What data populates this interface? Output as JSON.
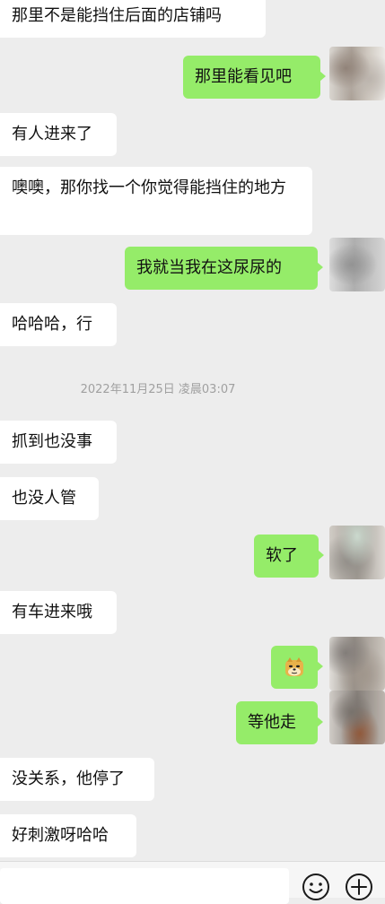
{
  "messages": [
    {
      "side": "left",
      "text": "那里不是能挡住后面的店铺吗"
    },
    {
      "side": "right",
      "text": "那里能看见吧"
    },
    {
      "side": "left",
      "text": "有人进来了"
    },
    {
      "side": "left",
      "text": "噢噢，那你找一个你觉得能挡住的地方"
    },
    {
      "side": "right",
      "text": "我就当我在这尿尿的"
    },
    {
      "side": "left",
      "text": "哈哈哈，行"
    },
    {
      "type": "timestamp",
      "text": "2022年11月25日 凌晨03:07"
    },
    {
      "side": "left",
      "text": "抓到也没事"
    },
    {
      "side": "left",
      "text": "也没人管"
    },
    {
      "side": "right",
      "text": "软了"
    },
    {
      "side": "left",
      "text": "有车进来哦"
    },
    {
      "side": "right",
      "type": "emoji",
      "emoji": "doge-emoji"
    },
    {
      "side": "right",
      "text": "等他走"
    },
    {
      "side": "left",
      "text": "没关系，他停了"
    },
    {
      "side": "left",
      "text": "好刺激呀哈哈"
    }
  ],
  "input_bar": {
    "icons": [
      "emoji-icon",
      "plus-icon"
    ]
  },
  "colors": {
    "background": "#ededed",
    "outgoing_bubble": "#95ec69",
    "incoming_bubble": "#ffffff",
    "timestamp_text": "#a0a0a0"
  }
}
